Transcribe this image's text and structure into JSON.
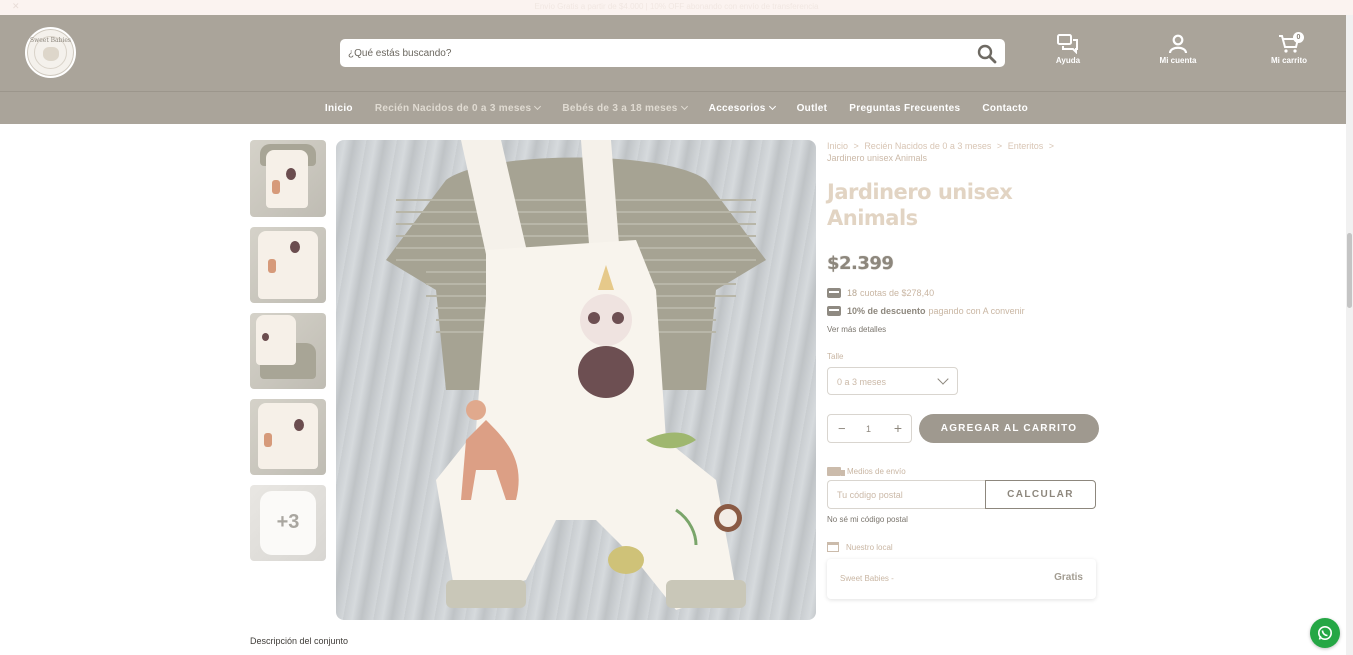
{
  "topbar": {
    "message": "Envío Gratis a partir de $4.000 | 10% OFF abonando con envío de transferencia"
  },
  "header": {
    "search_placeholder": "¿Qué estás buscando?",
    "help_label": "Ayuda",
    "account_label": "Mi cuenta",
    "cart_label": "Mi carrito",
    "cart_count": "0"
  },
  "nav": {
    "items": [
      {
        "label": "Inicio"
      },
      {
        "label": "Recién Nacidos de 0 a 3 meses"
      },
      {
        "label": "Bebés de 3 a 18 meses"
      },
      {
        "label": "Accesorios"
      },
      {
        "label": "Outlet"
      },
      {
        "label": "Preguntas Frecuentes"
      },
      {
        "label": "Contacto"
      }
    ]
  },
  "gallery": {
    "more_label": "+3"
  },
  "product": {
    "breadcrumb": [
      "Inicio",
      ">",
      "Recién Nacidos de 0 a 3 meses",
      ">",
      "Enteritos",
      ">",
      "Jardinero unisex Animals"
    ],
    "title": "Jardinero unisex Animals",
    "price": "$2.399",
    "installments_count": "18",
    "installments_text": "cuotas de $278,40",
    "discount_bold": "10% de descuento",
    "discount_text": "pagando con A convenir",
    "more_details": "Ver más detalles",
    "size_label": "Talle",
    "size_value": "0 a 3 meses",
    "quantity": "1",
    "add_to_cart": "AGREGAR AL CARRITO",
    "shipping_label": "Medios de envío",
    "postal_placeholder": "Tu código postal",
    "calculate": "CALCULAR",
    "no_postal": "No sé mi código postal",
    "local_label": "Nuestro local",
    "local_name": "Sweet Babies -",
    "local_price": "Gratis"
  },
  "description_title": "Descripción del conjunto",
  "logo_text": "Sweet Babies"
}
